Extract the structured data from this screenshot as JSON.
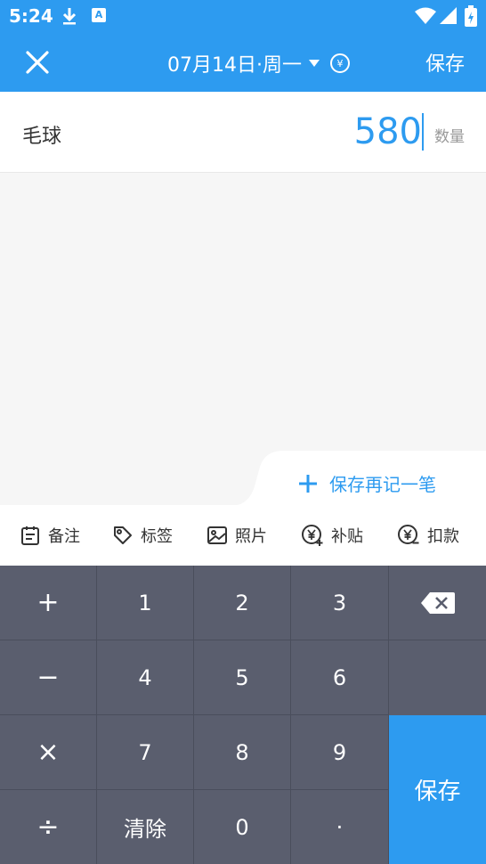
{
  "status": {
    "time": "5:24"
  },
  "header": {
    "date": "07月14日·周一",
    "save_label": "保存"
  },
  "item": {
    "name": "毛球",
    "amount": "580",
    "unit": "数量"
  },
  "save_again": {
    "label": "保存再记一笔"
  },
  "actions": [
    {
      "label": "备注",
      "icon": "notepad-icon"
    },
    {
      "label": "标签",
      "icon": "tag-icon"
    },
    {
      "label": "照片",
      "icon": "photo-icon"
    },
    {
      "label": "补贴",
      "icon": "yuan-plus-icon"
    },
    {
      "label": "扣款",
      "icon": "yuan-minus-icon"
    }
  ],
  "keypad": {
    "plus": "+",
    "minus": "−",
    "times": "×",
    "divide": "÷",
    "k1": "1",
    "k2": "2",
    "k3": "3",
    "k4": "4",
    "k5": "5",
    "k6": "6",
    "k7": "7",
    "k8": "8",
    "k9": "9",
    "clear": "清除",
    "k0": "0",
    "dot": "·",
    "save": "保存"
  },
  "colors": {
    "accent": "#2d9bf0",
    "keypad": "#5a5e6e"
  }
}
